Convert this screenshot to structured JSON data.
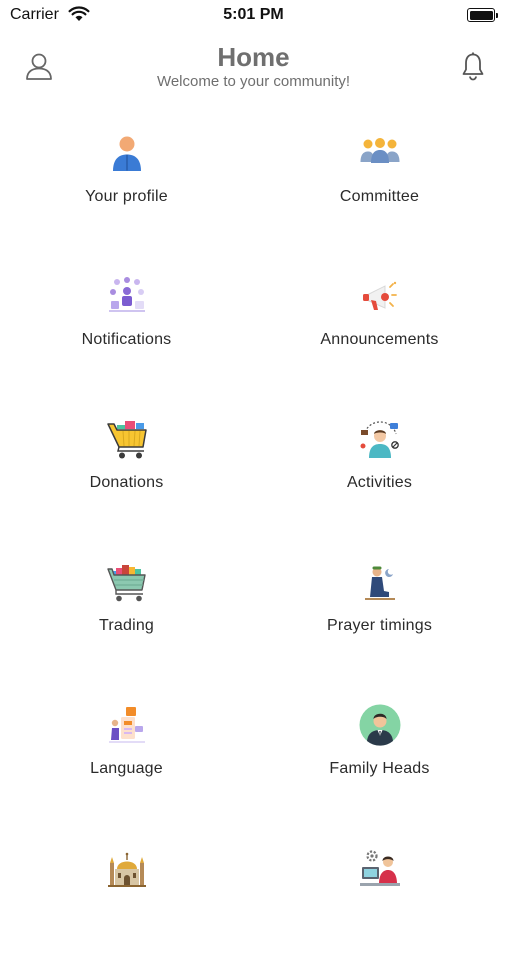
{
  "status_bar": {
    "carrier": "Carrier",
    "time": "5:01 PM"
  },
  "header": {
    "title": "Home",
    "subtitle": "Welcome to your community!"
  },
  "menu": [
    {
      "label": "Your profile",
      "icon": "profile-icon"
    },
    {
      "label": "Committee",
      "icon": "committee-icon"
    },
    {
      "label": "Notifications",
      "icon": "notifications-illustration-icon"
    },
    {
      "label": "Announcements",
      "icon": "megaphone-icon"
    },
    {
      "label": "Donations",
      "icon": "shopping-cart-icon"
    },
    {
      "label": "Activities",
      "icon": "activities-icon"
    },
    {
      "label": "Trading",
      "icon": "trading-cart-icon"
    },
    {
      "label": "Prayer timings",
      "icon": "prayer-icon"
    },
    {
      "label": "Language",
      "icon": "language-icon"
    },
    {
      "label": "Family Heads",
      "icon": "family-head-icon"
    },
    {
      "label": "",
      "icon": "mosque-icon"
    },
    {
      "label": "",
      "icon": "computer-user-icon"
    }
  ]
}
